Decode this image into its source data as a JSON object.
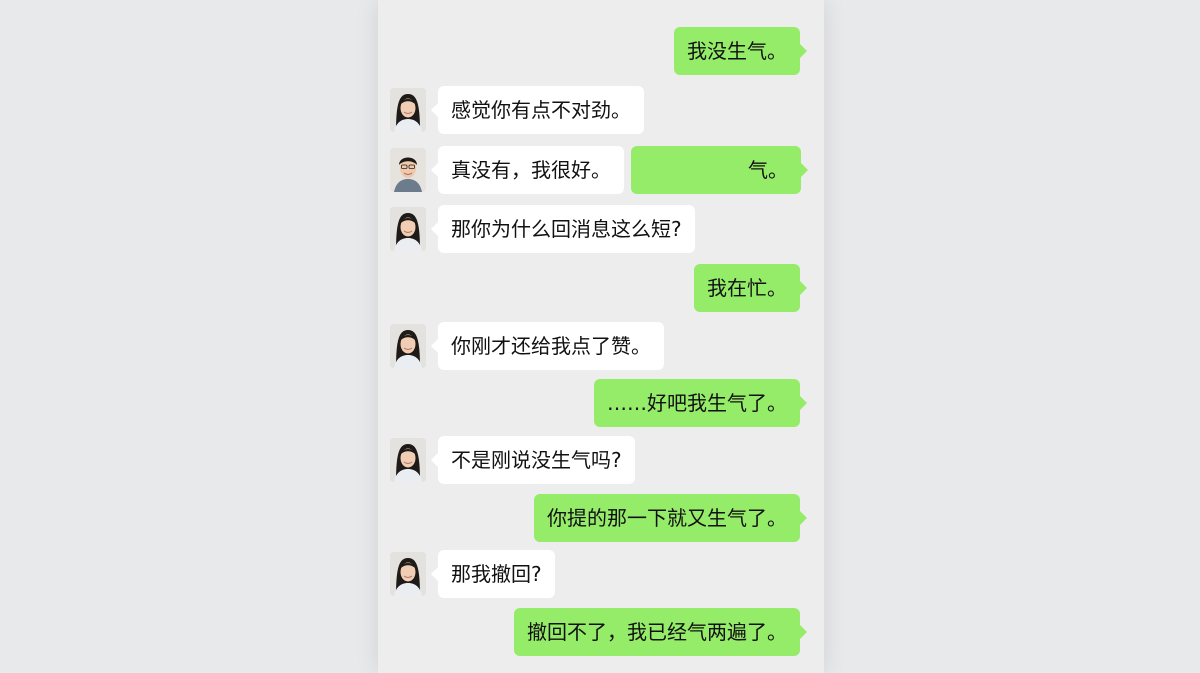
{
  "chat": {
    "messages": [
      {
        "side": "out",
        "text": "我没生气。"
      },
      {
        "side": "in",
        "avatar": "woman-avatar",
        "text": "感觉你有点不对劲。"
      },
      {
        "side": "in",
        "avatar": "man-avatar",
        "text": "真没有，我很好。"
      },
      {
        "side": "out",
        "text": "气。"
      },
      {
        "side": "in",
        "avatar": "woman-avatar",
        "text": "那你为什么回消息这么短?"
      },
      {
        "side": "out",
        "text": "我在忙。"
      },
      {
        "side": "in",
        "avatar": "woman-avatar",
        "text": "你刚才还给我点了赞。"
      },
      {
        "side": "out",
        "text": "……好吧我生气了。"
      },
      {
        "side": "in",
        "avatar": "woman-avatar",
        "text": "不是刚说没生气吗?"
      },
      {
        "side": "out",
        "text": "你提的那一下就又生气了。"
      },
      {
        "side": "in",
        "avatar": "woman-avatar",
        "text": "那我撤回?"
      },
      {
        "side": "out",
        "text": "撤回不了，我已经气两遍了。"
      }
    ]
  },
  "colors": {
    "outgoing_bubble": "#95ec69",
    "incoming_bubble": "#ffffff",
    "chat_background": "#ededed",
    "page_background": "#e8e9eb"
  }
}
